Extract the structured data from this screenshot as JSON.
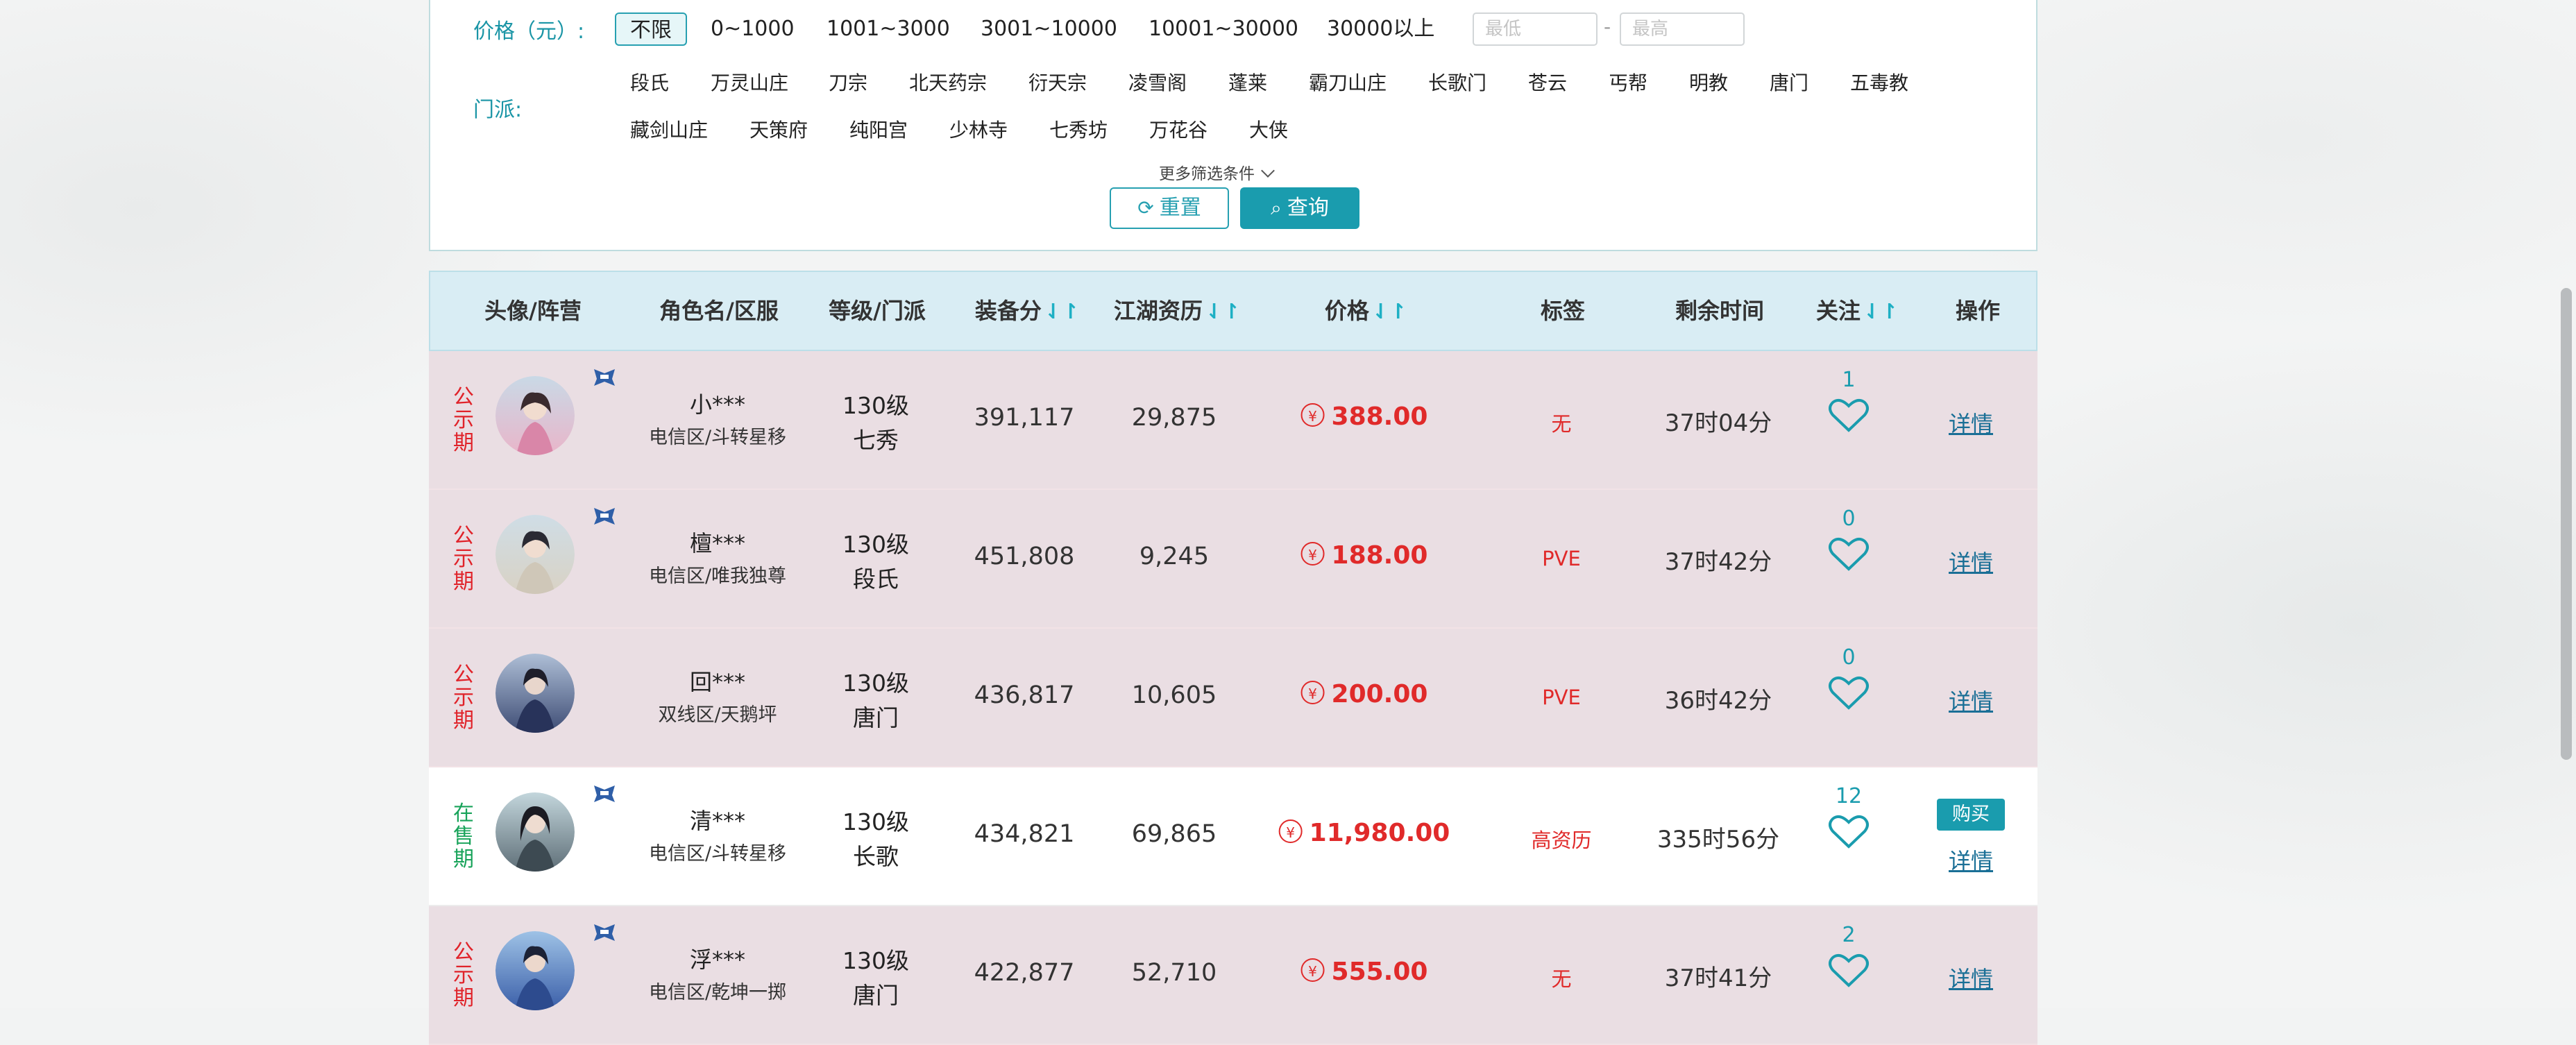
{
  "filters": {
    "price_label": "价格（元）:",
    "price_options": [
      "不限",
      "0~1000",
      "1001~3000",
      "3001~10000",
      "10001~30000",
      "30000以上"
    ],
    "price_min_placeholder": "最低",
    "price_dash": "-",
    "price_max_placeholder": "最高",
    "sect_label": "门派:",
    "sects_row1": [
      "段氏",
      "万灵山庄",
      "刀宗",
      "北天药宗",
      "衍天宗",
      "凌雪阁",
      "蓬莱",
      "霸刀山庄",
      "长歌门",
      "苍云",
      "丐帮",
      "明教",
      "唐门",
      "五毒教"
    ],
    "sects_row2": [
      "藏剑山庄",
      "天策府",
      "纯阳宫",
      "少林寺",
      "七秀坊",
      "万花谷",
      "大侠"
    ],
    "more_label": "更多筛选条件",
    "reset_label": "重置",
    "query_label": "查询"
  },
  "table": {
    "headers": {
      "avatar": "头像/阵营",
      "name": "角色名/区服",
      "level": "等级/门派",
      "gear": "装备分",
      "jianghu": "江湖资历",
      "price": "价格",
      "tag": "标签",
      "remaining": "剩余时间",
      "follow": "关注",
      "action": "操作"
    },
    "sort_glyph": "⇃↾",
    "yen_glyph": "¥",
    "rows": [
      {
        "status": "公示期",
        "name": "小***",
        "server": "电信区/斗转星移",
        "level": "130级",
        "sect": "七秀",
        "gear": "391,117",
        "jianghu": "29,875",
        "price": "388.00",
        "tag": "无",
        "remaining": "37时04分",
        "follow": "1",
        "detail": "详情",
        "has_camp": true
      },
      {
        "status": "公示期",
        "name": "檀***",
        "server": "电信区/唯我独尊",
        "level": "130级",
        "sect": "段氏",
        "gear": "451,808",
        "jianghu": "9,245",
        "price": "188.00",
        "tag": "PVE",
        "remaining": "37时42分",
        "follow": "0",
        "detail": "详情",
        "has_camp": true
      },
      {
        "status": "公示期",
        "name": "回***",
        "server": "双线区/天鹅坪",
        "level": "130级",
        "sect": "唐门",
        "gear": "436,817",
        "jianghu": "10,605",
        "price": "200.00",
        "tag": "PVE",
        "remaining": "36时42分",
        "follow": "0",
        "detail": "详情",
        "has_camp": false
      },
      {
        "status": "在售期",
        "name": "清***",
        "server": "电信区/斗转星移",
        "level": "130级",
        "sect": "长歌",
        "gear": "434,821",
        "jianghu": "69,865",
        "price": "11,980.00",
        "tag": "高资历",
        "remaining": "335时56分",
        "follow": "12",
        "detail": "详情",
        "buy": "购买",
        "has_camp": true
      },
      {
        "status": "公示期",
        "name": "浮***",
        "server": "电信区/乾坤一掷",
        "level": "130级",
        "sect": "唐门",
        "gear": "422,877",
        "jianghu": "52,710",
        "price": "555.00",
        "tag": "无",
        "remaining": "37时41分",
        "follow": "2",
        "detail": "详情",
        "has_camp": true
      }
    ]
  },
  "colors": {
    "accent": "#1a9cae",
    "price_red": "#e02a2a",
    "public_row_bg": "#eadee3",
    "header_bg": "#d9edf4",
    "on_sale_green": "#18a35a"
  }
}
